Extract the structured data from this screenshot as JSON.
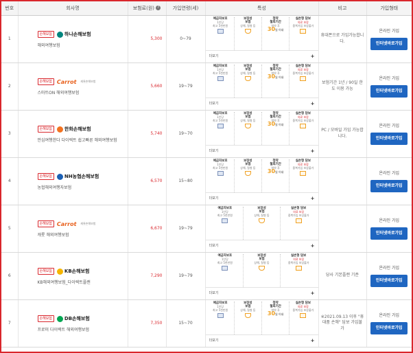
{
  "headers": {
    "no": "번호",
    "company": "회사명",
    "premium": "보험료(원)",
    "age": "가입연령(세)",
    "features": "특성",
    "note": "비고",
    "join": "가입형태"
  },
  "common": {
    "tag": "손해보험",
    "more": "더보기",
    "plus": "+",
    "status": "온라인 가입",
    "button": "인터넷바로가입",
    "help": "?"
  },
  "features_full": {
    "f1": {
      "title": "예금자보호",
      "sub1": "1인당",
      "sub2": "최고 5천만원",
      "icon": "kdic-badge-icon"
    },
    "f2": {
      "title": "보장성",
      "title2": "보험",
      "sub1": "상해, 질병 등",
      "icon": "hand-coin-icon"
    },
    "f3": {
      "title": "청약",
      "title2": "철회기간",
      "sub1": "청약 후",
      "big": "30",
      "unit": "일 이내"
    },
    "f4": {
      "title": "실손형 담보",
      "sub1": "의료 보장",
      "sub2": "중복가입 보상불가",
      "icon": "document-icon"
    }
  },
  "colors": {
    "accent": "#d9262c",
    "button": "#1f66c1",
    "icon": "#f0a020"
  },
  "rows": [
    {
      "no": "1",
      "logo": "하나손해보험",
      "logo_sub": "",
      "product": "해외여행보험",
      "premium": "5,300",
      "age": "0~79",
      "note": "휴대폰으로 가입가능합니다.",
      "features": 4
    },
    {
      "no": "2",
      "logo": "Carrot",
      "logo_sub": "캐롯손해보험",
      "product": "스마트ON 해외여행보험",
      "premium": "5,660",
      "age": "19~79",
      "note": "보험기간 1년 / 90일 한도 이용 가능",
      "features": 4
    },
    {
      "no": "3",
      "logo": "한화손해보험",
      "logo_sub": "",
      "product": "안심여행한다 다이렉트 쉽고빠른 해외여행보험",
      "premium": "5,740",
      "age": "19~70",
      "note": "PC / 모바일 가입 가능합니다.",
      "features": 4
    },
    {
      "no": "4",
      "logo": "NH농협손해보험",
      "logo_sub": "",
      "product": "농협해외여행자보험",
      "premium": "6,570",
      "age": "15~80",
      "note": "",
      "features": 4
    },
    {
      "no": "5",
      "logo": "Carrot",
      "logo_sub": "캐롯손해보험",
      "product": "캐롯 해외여행보험",
      "premium": "6,670",
      "age": "19~79",
      "note": "",
      "features": 3
    },
    {
      "no": "6",
      "logo": "KB손해보험",
      "logo_sub": "",
      "product": "KB해외여행보험_다이렉트플랜",
      "premium": "7,290",
      "age": "19~79",
      "note": "당사 기본플랜 기준",
      "features": 3
    },
    {
      "no": "7",
      "logo": "DB손해보험",
      "logo_sub": "",
      "product": "프로미 다이렉트 해외여행보험",
      "premium": "7,350",
      "age": "15~70",
      "note": "※2021.09.13 이후 \"휴대품 손해\" 담보 가입불가",
      "features": 4
    }
  ]
}
